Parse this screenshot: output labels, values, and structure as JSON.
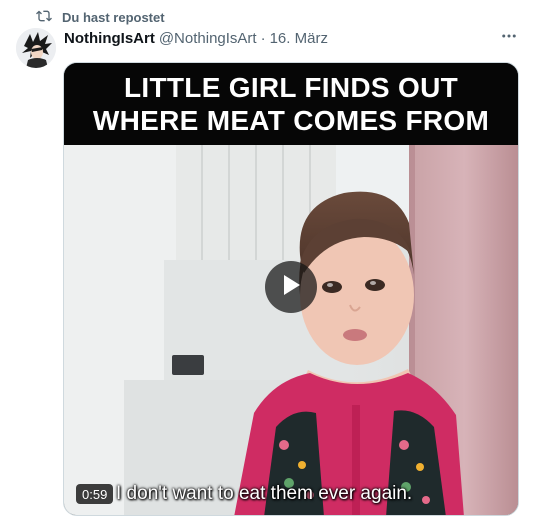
{
  "repost": {
    "label": "Du hast repostet",
    "icon": "repost-icon"
  },
  "tweet": {
    "author": {
      "display_name": "NothingIsArt",
      "handle": "@NothingIsArt",
      "avatar_icon": "avatar-character"
    },
    "separator": "·",
    "date": "16. März",
    "more_icon": "more-icon"
  },
  "media": {
    "title_lines": [
      "LITTLE GIRL FINDS OUT",
      "WHERE MEAT COMES FROM"
    ],
    "subtitle": "I don't want to eat them ever again.",
    "duration": "0:59",
    "play_icon": "play-icon"
  },
  "colors": {
    "text_primary": "#0f1419",
    "text_secondary": "#536471",
    "title_band": "#060606"
  }
}
